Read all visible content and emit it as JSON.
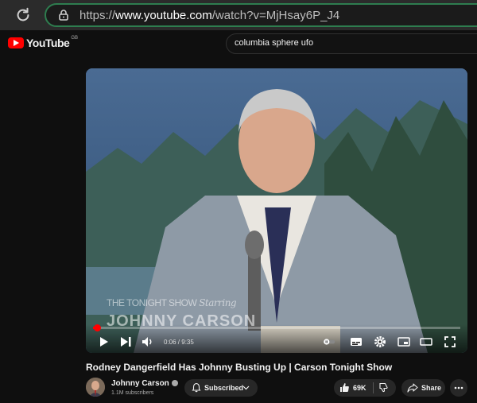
{
  "browser": {
    "url_prefix": "https://",
    "url_host": "www.youtube.com",
    "url_path": "/watch?v=MjHsay6P_J4"
  },
  "header": {
    "logo_text": "YouTube",
    "country_code": "GB",
    "search_value": "columbia sphere ufo"
  },
  "player": {
    "watermark_line1": "THE TONIGHT SHOW",
    "watermark_italic": "Starring",
    "watermark_line2": "JOHNNY CARSON",
    "time_current": "0:06",
    "time_separator": " / ",
    "time_total": "9:35",
    "progress_fraction": 0.0104
  },
  "video": {
    "title": "Rodney Dangerfield Has Johnny Busting Up | Carson Tonight Show",
    "channel_name": "Johnny Carson",
    "subscribers": "1.1M subscribers",
    "subscribed_label": "Subscribed",
    "likes": "69K",
    "share_label": "Share"
  },
  "colors": {
    "accent": "#ff0000",
    "page_bg": "#0f0f0f",
    "pill_bg": "#272727"
  }
}
